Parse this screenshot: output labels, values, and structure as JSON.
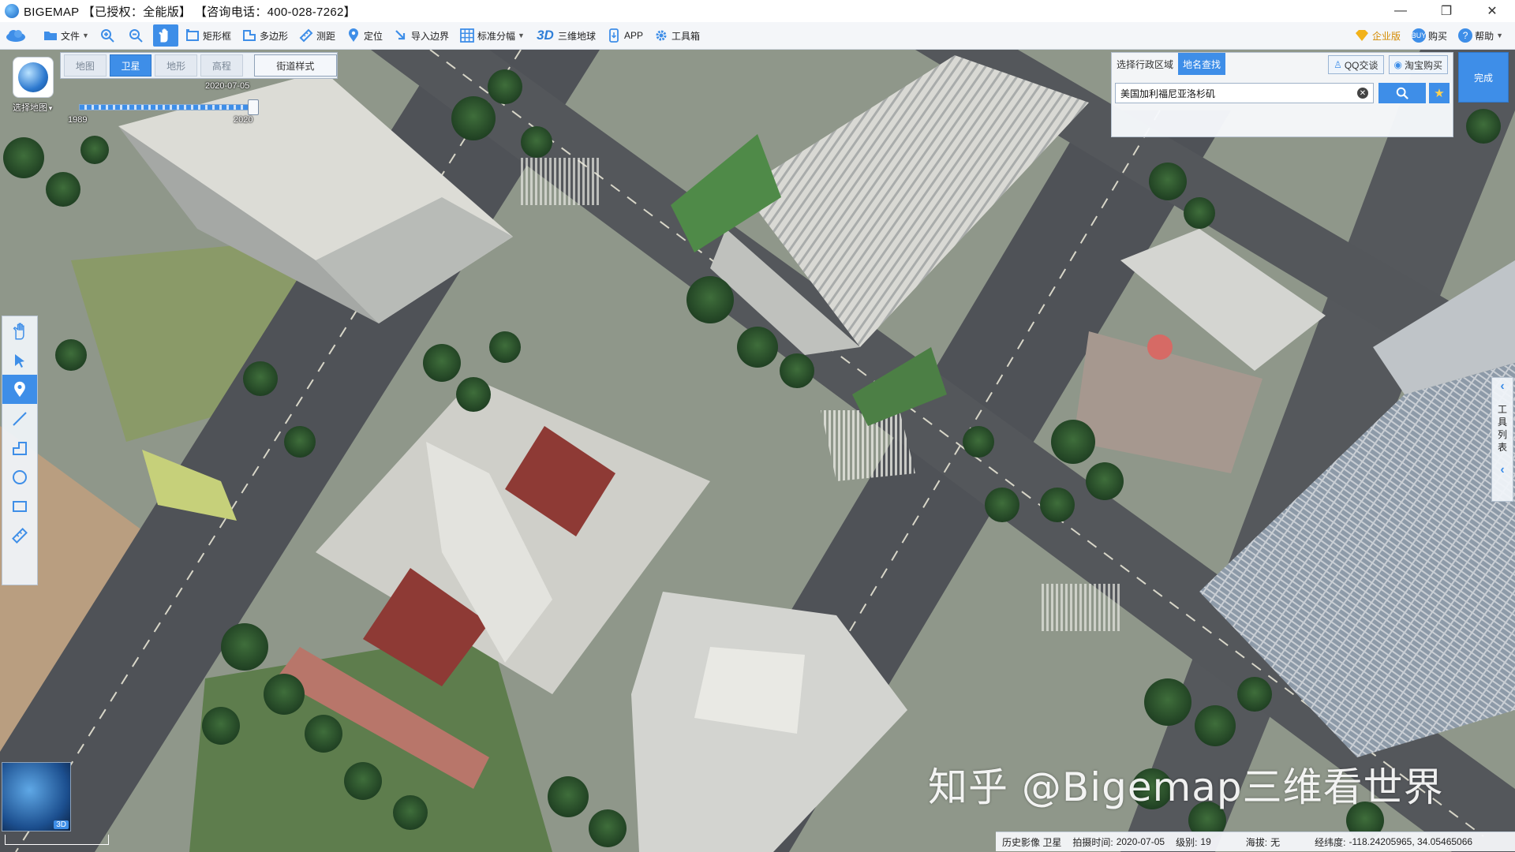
{
  "window": {
    "title": "BIGEMAP 【已授权：全能版】 【咨询电话：400-028-7262】",
    "controls": [
      "—",
      "❐",
      "✕"
    ]
  },
  "toolbar": {
    "items": [
      {
        "name": "file",
        "label": "文件",
        "icon": "folder-icon"
      },
      {
        "name": "zoom-in",
        "label": "",
        "icon": "zoom-in-icon"
      },
      {
        "name": "zoom-out",
        "label": "",
        "icon": "zoom-out-icon"
      },
      {
        "name": "pan",
        "label": "",
        "icon": "hand-icon"
      },
      {
        "name": "rectangle",
        "label": "矩形框",
        "icon": "rectangle-select-icon"
      },
      {
        "name": "polygon",
        "label": "多边形",
        "icon": "polygon-icon"
      },
      {
        "name": "measure",
        "label": "测距",
        "icon": "ruler-icon"
      },
      {
        "name": "locate",
        "label": "定位",
        "icon": "location-pin-icon"
      },
      {
        "name": "import-boundary",
        "label": "导入边界",
        "icon": "import-icon"
      },
      {
        "name": "standard-sheet",
        "label": "标准分幅",
        "icon": "grid-icon"
      },
      {
        "name": "3d-globe",
        "label": "三维地球",
        "icon": "3d-icon"
      },
      {
        "name": "app",
        "label": "APP",
        "icon": "phone-icon"
      },
      {
        "name": "toolbox",
        "label": "工具箱",
        "icon": "gear-icon"
      }
    ],
    "right": [
      {
        "name": "enterprise",
        "label": "企业版",
        "icon": "diamond-icon"
      },
      {
        "name": "buy",
        "label": "购买",
        "icon": "buy-icon"
      },
      {
        "name": "help",
        "label": "帮助",
        "icon": "help-icon"
      }
    ]
  },
  "map_selector": {
    "label": "选择地图"
  },
  "map_types": {
    "tabs": [
      "地图",
      "卫星",
      "地形",
      "高程"
    ],
    "selected": "卫星",
    "street_style": "街道样式"
  },
  "timeline": {
    "current_date": "2020-07-05",
    "start_year": "1989",
    "end_year": "2020",
    "position": 1.0
  },
  "left_tools": [
    "hand-icon",
    "pointer-icon",
    "marker-icon",
    "line-icon",
    "polyline-icon",
    "circle-icon",
    "rectangle-icon",
    "ruler-icon"
  ],
  "search_panel": {
    "tabs": [
      "选择行政区域",
      "地名查找"
    ],
    "selected_tab": "地名查找",
    "links": [
      {
        "label": "QQ交谈",
        "icon": "qq-icon"
      },
      {
        "label": "淘宝购买",
        "icon": "taobao-icon"
      }
    ],
    "query": "美国加利福尼亚洛杉矶"
  },
  "done_button": "完成",
  "right_dock": {
    "label": "工具列表"
  },
  "minimap": {
    "badge": "3D"
  },
  "watermark": "知乎 @Bigemap三维看世界",
  "status_bar": {
    "imagery": "历史影像 卫星",
    "capture_label": "拍摄时间:",
    "capture_date": "2020-07-05",
    "level_label": "级别:",
    "level": "19",
    "altitude_label": "海拔:",
    "altitude": "无",
    "coords_label": "经纬度:",
    "coords": "-118.24205965, 34.05465066"
  },
  "colors": {
    "accent": "#3e8ee8",
    "toolbar_bg": "#f4f6f9",
    "map_bg": "#7f8b7b"
  }
}
